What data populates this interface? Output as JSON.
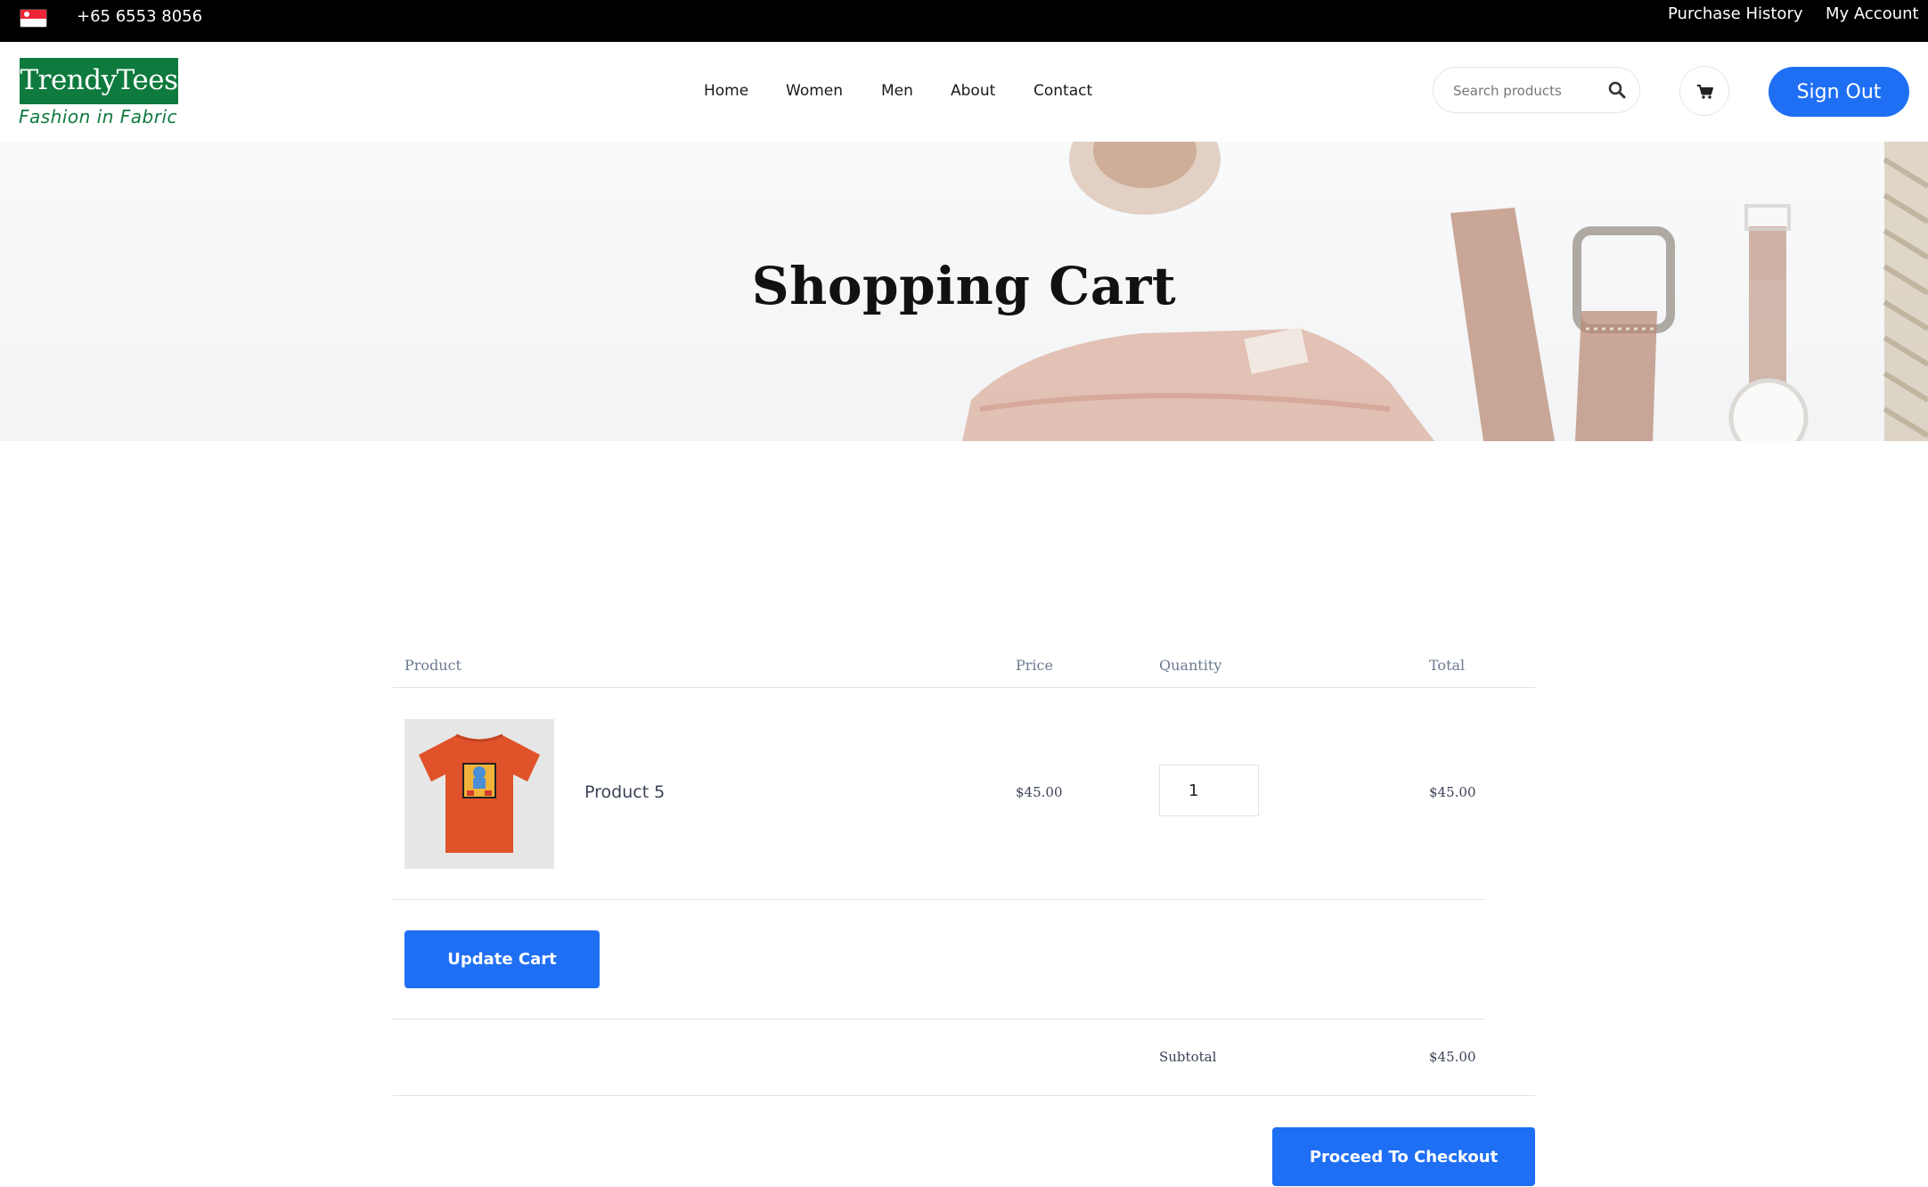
{
  "topbar": {
    "phone": "+65 6553 8056",
    "purchase_history": "Purchase History",
    "my_account": "My Account"
  },
  "header": {
    "logo_name": "TrendyTees",
    "logo_tagline": "Fashion in Fabric",
    "nav": [
      "Home",
      "Women",
      "Men",
      "About",
      "Contact"
    ],
    "search_placeholder": "Search products",
    "sign_out": "Sign Out"
  },
  "hero": {
    "title": "Shopping Cart"
  },
  "cart": {
    "columns": [
      "Product",
      "Price",
      "Quantity",
      "Total"
    ],
    "items": [
      {
        "name": "Product 5",
        "price": "$45.00",
        "quantity": "1",
        "total": "$45.00"
      }
    ],
    "update_button": "Update Cart",
    "subtotal_label": "Subtotal",
    "subtotal_value": "$45.00",
    "checkout_button": "Proceed To Checkout"
  },
  "colors": {
    "accent": "#1f6ff5",
    "brand_green": "#0e7a3e",
    "topbar": "#000000"
  },
  "icons": [
    "singapore-flag-icon",
    "search-icon",
    "cart-icon"
  ]
}
